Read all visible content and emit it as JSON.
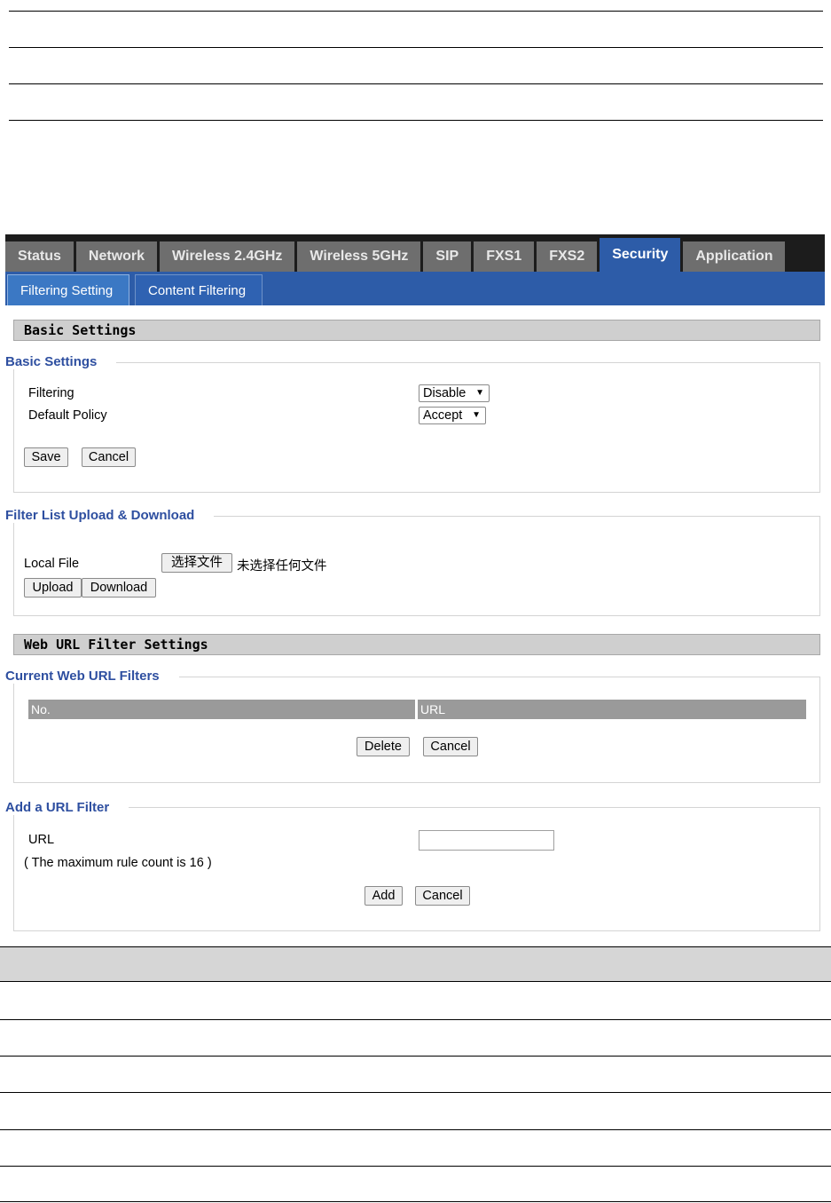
{
  "nav": {
    "tabs": [
      {
        "label": "Status"
      },
      {
        "label": "Network"
      },
      {
        "label": "Wireless 2.4GHz"
      },
      {
        "label": "Wireless 5GHz"
      },
      {
        "label": "SIP"
      },
      {
        "label": "FXS1"
      },
      {
        "label": "FXS2"
      },
      {
        "label": "Security"
      },
      {
        "label": "Application"
      }
    ],
    "active_tab": "Security",
    "subtabs": [
      {
        "label": "Filtering Setting"
      },
      {
        "label": "Content Filtering"
      }
    ],
    "active_subtab": "Filtering Setting"
  },
  "basic": {
    "section_title": "Basic Settings",
    "legend": "Basic Settings",
    "filtering_label": "Filtering",
    "filtering_value": "Disable",
    "policy_label": "Default Policy",
    "policy_value": "Accept",
    "save": "Save",
    "cancel": "Cancel"
  },
  "filter_list": {
    "legend": "Filter List Upload & Download",
    "local_file_label": "Local File",
    "choose_file": "选择文件",
    "no_file": "未选择任何文件",
    "upload": "Upload",
    "download": "Download"
  },
  "web_url": {
    "section_title": "Web URL Filter Settings",
    "current_legend": "Current Web URL Filters",
    "columns": [
      "No.",
      "URL"
    ],
    "delete": "Delete",
    "cancel": "Cancel"
  },
  "add_url": {
    "legend": "Add a URL Filter",
    "url_label": "URL",
    "url_value": "",
    "note": "( The maximum rule count is 16 )",
    "add": "Add",
    "cancel": "Cancel"
  },
  "colors": {
    "nav_bg": "#1c1c1c",
    "tab_bg": "#6e6e6e",
    "accent": "#2d5ca8",
    "legend_text": "#2e4fa0"
  }
}
